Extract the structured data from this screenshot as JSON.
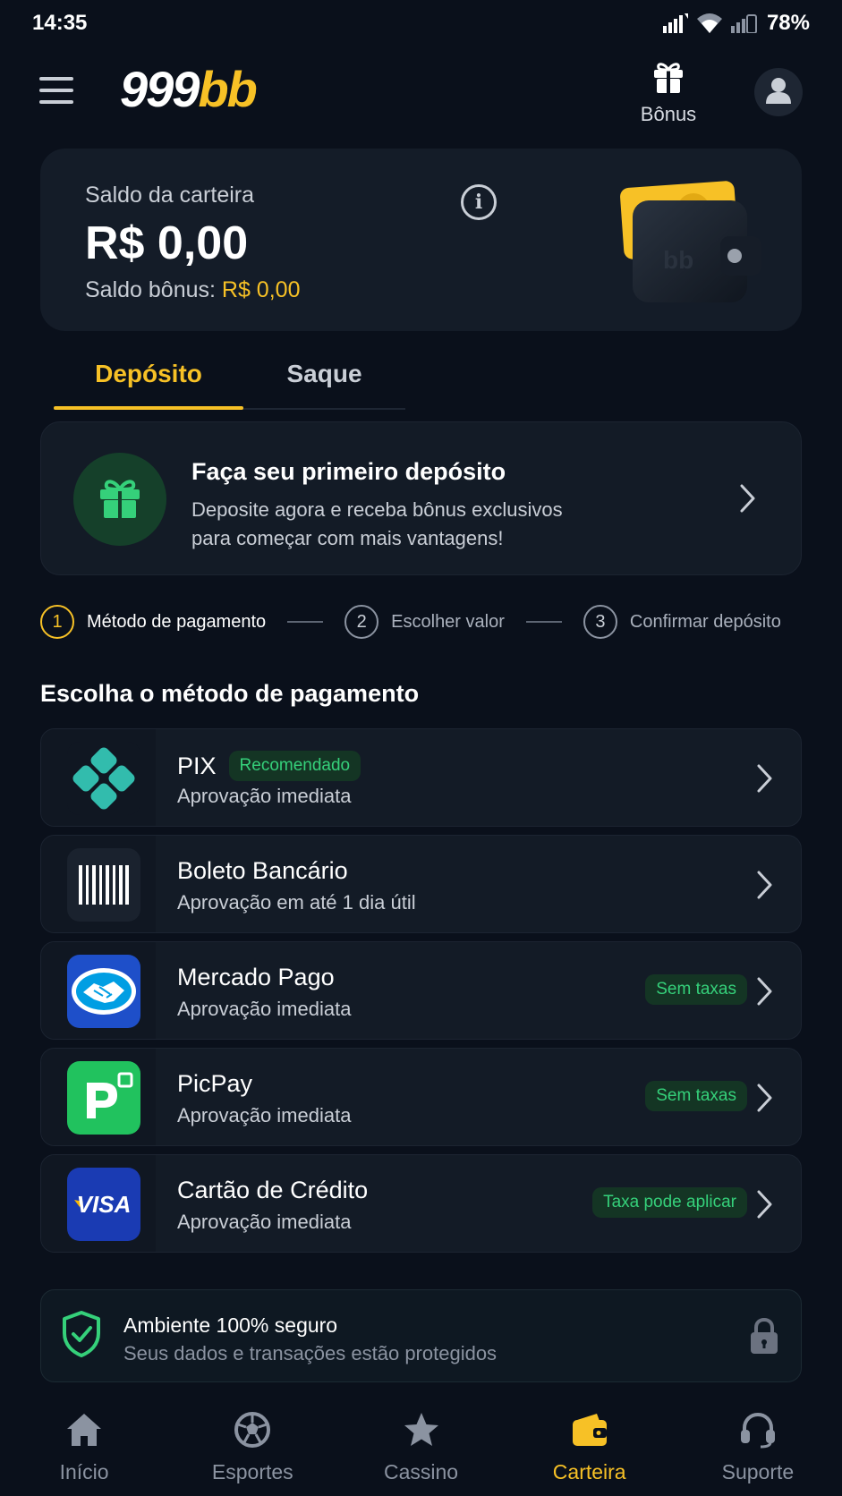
{
  "status_bar": {
    "time": "14:35",
    "battery": "78%"
  },
  "header": {
    "logo_part1": "999",
    "logo_part2": "bb",
    "bonus_label": "Bônus"
  },
  "wallet": {
    "label": "Saldo da carteira",
    "balance": "R$ 0,00",
    "bonus_label": "Saldo bônus:",
    "bonus_value": "R$ 0,00",
    "art_text": "bb"
  },
  "tabs": [
    {
      "label": "Depósito",
      "active": true
    },
    {
      "label": "Saque",
      "active": false
    }
  ],
  "promo": {
    "title": "Faça seu primeiro depósito",
    "line1": "Deposite agora e receba bônus exclusivos",
    "line2": "para começar com mais vantagens!"
  },
  "steps": [
    {
      "number": "1",
      "label": "Método de pagamento",
      "active": true
    },
    {
      "number": "2",
      "label": "Escolher valor",
      "active": false
    },
    {
      "number": "3",
      "label": "Confirmar depósito",
      "active": false
    }
  ],
  "section_title": "Escolha o método de pagamento",
  "payment_methods": [
    {
      "name": "PIX",
      "badge": "Recomendado",
      "desc": "Aprovação imediata",
      "icon": "pix-icon"
    },
    {
      "name": "Boleto Bancário",
      "desc": "Aprovação em até 1 dia útil",
      "icon": "barcode-icon"
    },
    {
      "name": "Mercado Pago",
      "desc": "Aprovação imediata",
      "tag": "Sem taxas",
      "icon": "mercado-pago-logo"
    },
    {
      "name": "PicPay",
      "desc": "Aprovação imediata",
      "tag": "Sem taxas",
      "icon": "picpay-logo"
    },
    {
      "name": "Cartão de Crédito",
      "desc": "Aprovação imediata",
      "tag": "Taxa pode aplicar",
      "icon": "visa-logo",
      "logo_text": "VISA"
    }
  ],
  "security": {
    "title": "Ambiente 100% seguro",
    "text": "Seus dados e transações estão protegidos"
  },
  "bottom_nav": [
    {
      "label": "Início",
      "icon": "home-icon",
      "active": false
    },
    {
      "label": "Esportes",
      "icon": "soccer-ball-icon",
      "active": false
    },
    {
      "label": "Cassino",
      "icon": "star-icon",
      "active": false
    },
    {
      "label": "Carteira",
      "icon": "wallet-icon",
      "active": true
    },
    {
      "label": "Suporte",
      "icon": "headset-icon",
      "active": false
    }
  ],
  "colors": {
    "background": "#0a101b",
    "card": "#131b26",
    "accent": "#f7c126",
    "success": "#35d07a",
    "pix": "#32bcad",
    "mercado_pago": "#009ee3",
    "picpay": "#21c25e",
    "visa": "#1a3bb3"
  }
}
